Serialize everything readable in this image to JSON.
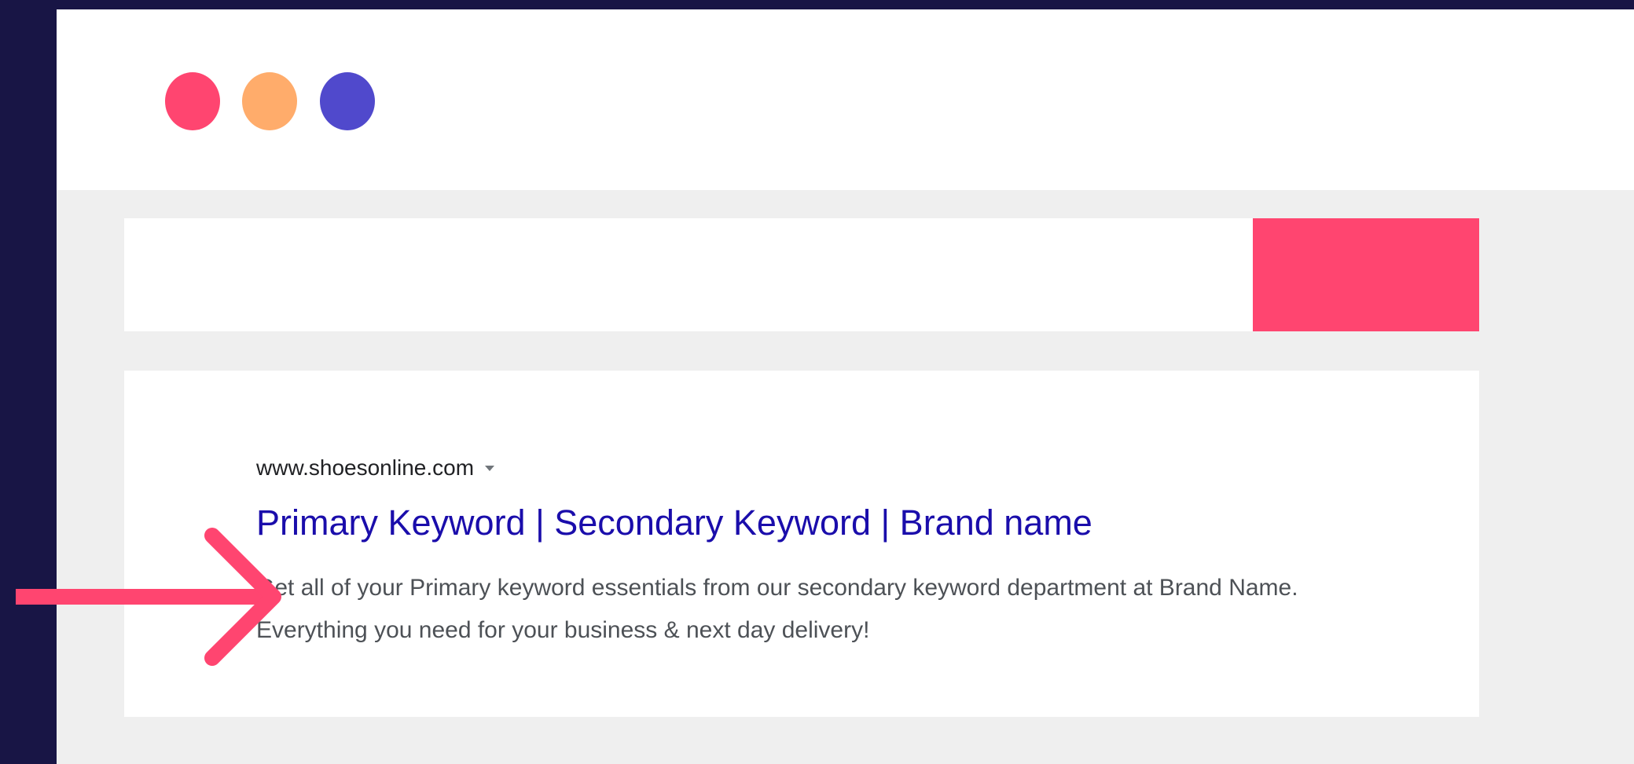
{
  "window": {
    "controls": [
      {
        "name": "close",
        "color": "#ff4570"
      },
      {
        "name": "minimize",
        "color": "#ffac6b"
      },
      {
        "name": "maximize",
        "color": "#5049cc"
      }
    ]
  },
  "search": {
    "query": "",
    "button_color": "#ff4570"
  },
  "result": {
    "url": "www.shoesonline.com",
    "title": "Primary Keyword | Secondary Keyword | Brand name",
    "description": "Get all of your Primary keyword essentials from our secondary keyword department at Brand Name. Everything you need for your business & next day delivery!"
  },
  "colors": {
    "background": "#181545",
    "accent": "#ff4570",
    "link": "#1a0dab"
  },
  "icons": {
    "pointer": "arrow-right-icon",
    "url_menu": "caret-down-icon"
  }
}
